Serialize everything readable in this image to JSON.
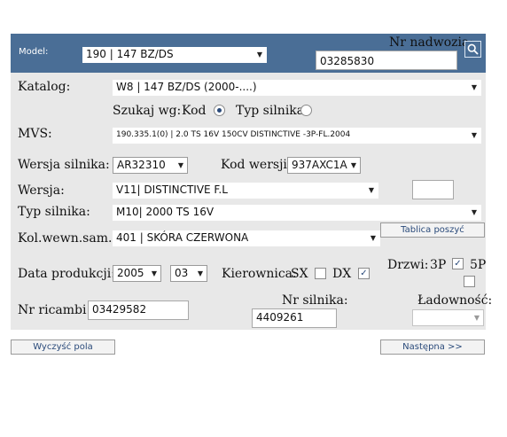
{
  "header": {
    "model_label": "Model:",
    "model_value": "190 | 147 BZ/DS",
    "chassis_label": "Nr nadwozia:",
    "chassis_value": "03285830"
  },
  "katalog": {
    "label": "Katalog:",
    "value": "W8 | 147 BZ/DS (2000-....)"
  },
  "search_by": {
    "label": "Szukaj wg:",
    "option_code": "Kod",
    "option_engine": "Typ silnika",
    "selected": "Kod"
  },
  "mvs": {
    "label": "MVS:",
    "value": "190.335.1(0) | 2.0 TS 16V 150CV DISTINCTIVE -3P-FL.2004"
  },
  "engine_version": {
    "label": "Wersja silnika:",
    "value": "AR32310"
  },
  "version_code": {
    "label": "Kod wersji:",
    "value": "937AXC1A"
  },
  "wersja": {
    "label": "Wersja:",
    "value": "V11| DISTINCTIVE F.L",
    "extra_value": ""
  },
  "engine_type": {
    "label": "Typ silnika:",
    "value": "M10| 2000 TS 16V"
  },
  "interior_color": {
    "label": "Kol.wewn.sam.:",
    "value": "401 | SKÓRA CZERWONA",
    "table_button": "Tablica poszyć"
  },
  "production_date": {
    "label": "Data produkcji:",
    "year": "2005",
    "month": "03"
  },
  "steering": {
    "label": "Kierownica:",
    "opt_sx": "SX",
    "opt_dx": "DX",
    "sx_checked": false,
    "dx_checked": true
  },
  "doors": {
    "label": "Drzwi:",
    "opt_3p": "3P",
    "opt_5p": "5P",
    "p3_checked": true,
    "p5_checked": false
  },
  "spare_number": {
    "label": "Nr ricambi:",
    "value": "03429582"
  },
  "engine_number": {
    "label": "Nr silnika:",
    "value": "4409261"
  },
  "capacity": {
    "label": "Ładowność:",
    "value": ""
  },
  "buttons": {
    "clear": "Wyczyść pola",
    "next": "Następna >>"
  },
  "icons": {
    "search": "search-icon",
    "dropdown": "chevron-down-icon"
  },
  "colors": {
    "header": "#4a6e96",
    "form_bg": "#e8e8e8",
    "button_text": "#2a4a7a"
  }
}
